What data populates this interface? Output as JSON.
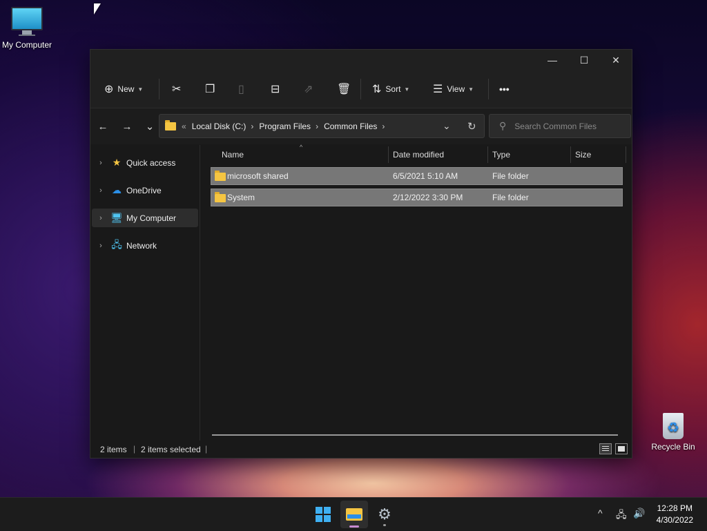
{
  "desktop": {
    "icons": [
      {
        "label": "My Computer",
        "icon": "monitor-icon"
      },
      {
        "label": "Recycle Bin",
        "icon": "recycle-bin-icon"
      }
    ]
  },
  "window": {
    "controls": {
      "minimize": "—",
      "maximize": "☐",
      "close": "✕"
    },
    "toolbar": {
      "new_label": "New",
      "sort_label": "Sort",
      "view_label": "View",
      "more_label": "•••",
      "icons": [
        "plus-circle-icon",
        "cut-icon",
        "copy-icon",
        "paste-icon",
        "rename-icon",
        "share-icon",
        "delete-icon",
        "sort-icon",
        "view-icon"
      ]
    },
    "nav": {
      "back": "←",
      "forward": "→",
      "recent": "⌄",
      "breadcrumb": [
        "Local Disk (C:)",
        "Program Files",
        "Common Files"
      ],
      "overflow": "«",
      "separator": "›",
      "refresh": "↻",
      "dropdown": "⌄",
      "search_placeholder": "Search Common Files"
    },
    "sidebar": {
      "items": [
        {
          "label": "Quick access",
          "icon": "star-icon",
          "selected": false
        },
        {
          "label": "OneDrive",
          "icon": "cloud-icon",
          "selected": false
        },
        {
          "label": "My Computer",
          "icon": "monitor-icon",
          "selected": true
        },
        {
          "label": "Network",
          "icon": "network-icon",
          "selected": false
        }
      ]
    },
    "columns": {
      "name": "Name",
      "date": "Date modified",
      "type": "Type",
      "size": "Size"
    },
    "files": [
      {
        "name": "microsoft shared",
        "date": "6/5/2021 5:10 AM",
        "type": "File folder",
        "size": ""
      },
      {
        "name": "System",
        "date": "2/12/2022 3:30 PM",
        "type": "File folder",
        "size": ""
      }
    ],
    "status": {
      "count": "2 items",
      "selected": "2 items selected"
    }
  },
  "taskbar": {
    "apps": [
      "start-icon",
      "file-explorer-icon",
      "settings-icon"
    ],
    "tray": {
      "chevron": "^"
    },
    "clock": {
      "time": "12:28 PM",
      "date": "4/30/2022"
    }
  },
  "colors": {
    "accent": "#3fb0f2",
    "folder": "#f5c542",
    "selection": "#777777"
  }
}
